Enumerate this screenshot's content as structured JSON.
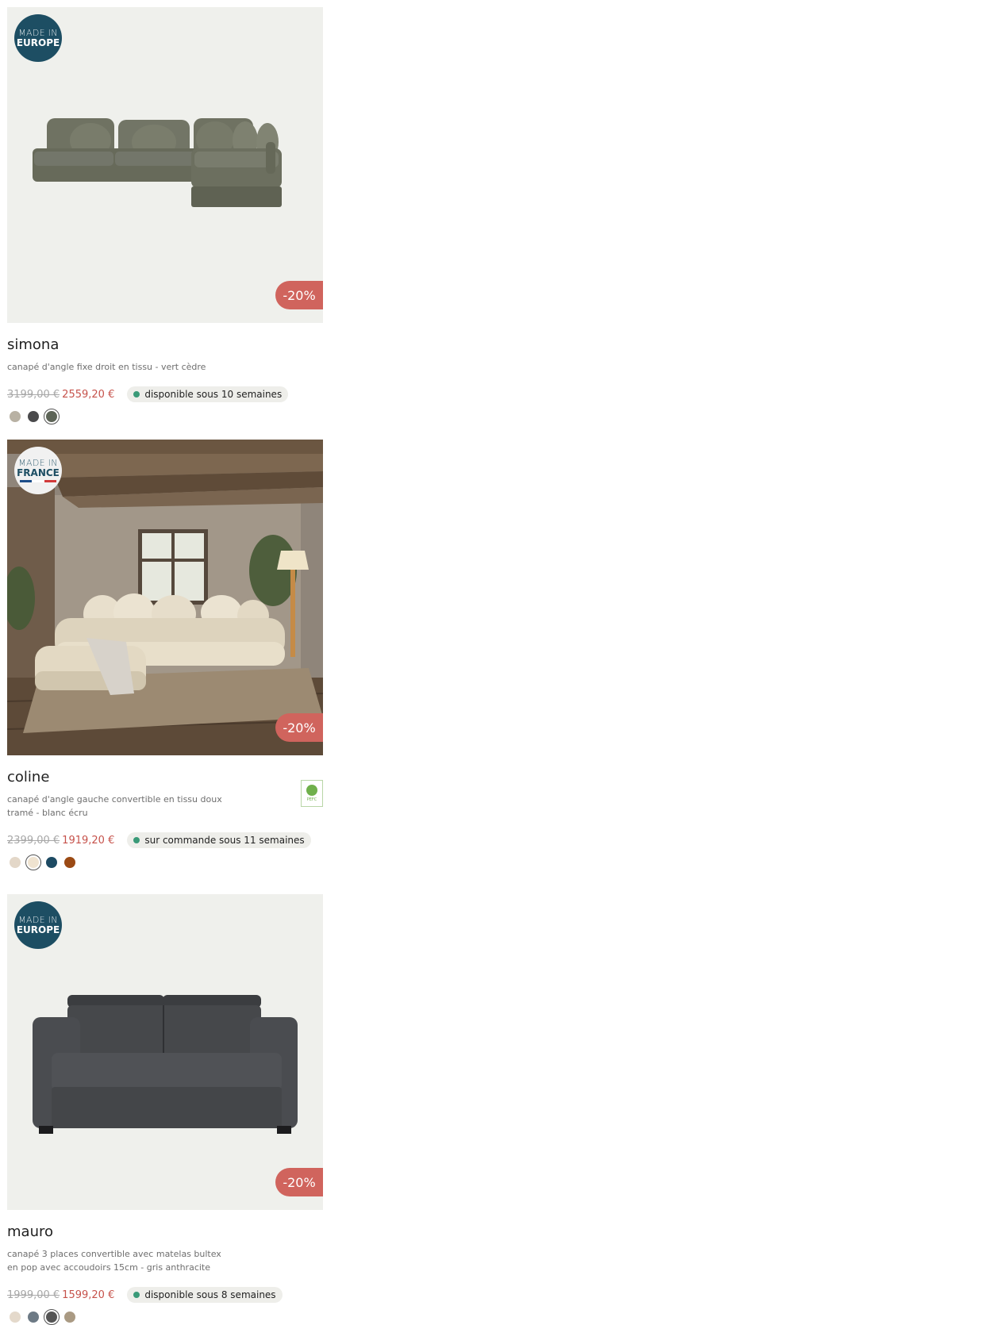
{
  "products": [
    {
      "origin": {
        "line1": "MADE IN",
        "line2": "EUROPE"
      },
      "discount": "-20%",
      "name": "simona",
      "description": "canapé d'angle fixe droit en tissu - vert cèdre",
      "old_price": "3199,00 €",
      "new_price": "2559,20 €",
      "availability": "disponible sous 10 semaines",
      "swatches": [
        {
          "color": "#b8b1a3",
          "selected": false
        },
        {
          "color": "#4a4a4c",
          "selected": false
        },
        {
          "color": "#5d6457",
          "selected": true
        }
      ]
    },
    {
      "origin": {
        "line1": "MADE IN",
        "line2": "FRANCE"
      },
      "discount": "-20%",
      "name": "coline",
      "description": "canapé d'angle gauche convertible en tissu doux tramé - blanc écru",
      "certification": "PEFC",
      "old_price": "2399,00 €",
      "new_price": "1919,20 €",
      "availability": "sur commande sous 11 semaines",
      "swatches": [
        {
          "color": "#e3d7c8",
          "selected": false
        },
        {
          "color": "#efe3d0",
          "selected": true
        },
        {
          "color": "#1d4a63",
          "selected": false
        },
        {
          "color": "#9b4a14",
          "selected": false
        }
      ]
    },
    {
      "origin": {
        "line1": "MADE IN",
        "line2": "EUROPE"
      },
      "discount": "-20%",
      "name": "mauro",
      "description": "canapé 3 places convertible avec matelas bultex en pop avec accoudoirs 15cm - gris anthracite",
      "old_price": "1999,00 €",
      "new_price": "1599,20 €",
      "availability": "disponible sous 8 semaines",
      "swatches": [
        {
          "color": "#e4d9cb",
          "selected": false
        },
        {
          "color": "#6d7a85",
          "selected": false
        },
        {
          "color": "#555555",
          "selected": true
        },
        {
          "color": "#aa9a83",
          "selected": false
        }
      ]
    }
  ]
}
